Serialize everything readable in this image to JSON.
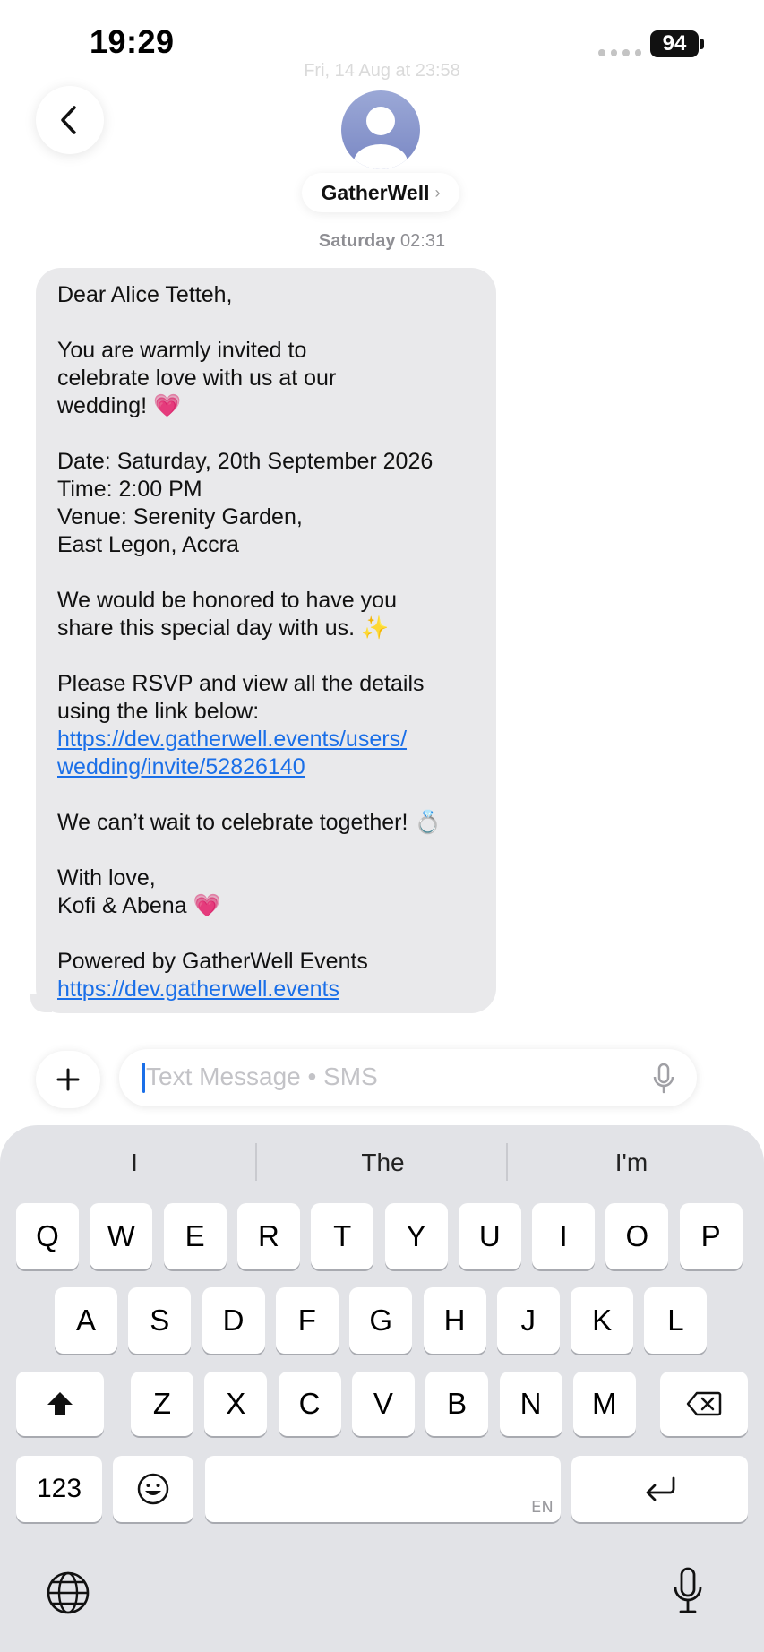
{
  "status": {
    "time": "19:29",
    "battery": "94"
  },
  "header": {
    "date": "Fri, 14 Aug at 23:58",
    "contact_name": "GatherWell",
    "chevron": "›"
  },
  "thread": {
    "timestamp_day": "Saturday",
    "timestamp_time": "02:31",
    "message_lines": [
      {
        "text": "Dear Alice Tetteh,"
      },
      {
        "text": ""
      },
      {
        "text": "You are warmly invited to"
      },
      {
        "text": "celebrate love with us at our"
      },
      {
        "text": "wedding! 💗"
      },
      {
        "text": ""
      },
      {
        "text": "Date: Saturday, 20th September 2026"
      },
      {
        "text": "Time: 2:00 PM"
      },
      {
        "text": "Venue: Serenity Garden,"
      },
      {
        "text": "East Legon, Accra"
      },
      {
        "text": ""
      },
      {
        "text": "We would be honored to have you"
      },
      {
        "text": "share this special day with us. ✨"
      },
      {
        "text": ""
      },
      {
        "text": "Please RSVP and view all the details"
      },
      {
        "text": "using the link below:"
      },
      {
        "text": "https://dev.gatherwell.events/users/",
        "link": true
      },
      {
        "text": "wedding/invite/52826140",
        "link": true
      },
      {
        "text": ""
      },
      {
        "text": "We can’t wait to celebrate together! 💍"
      },
      {
        "text": ""
      },
      {
        "text": "With love,"
      },
      {
        "text": "Kofi & Abena 💗"
      },
      {
        "text": ""
      },
      {
        "text": "Powered by GatherWell Events"
      },
      {
        "text": "https://dev.gatherwell.events",
        "link": true
      }
    ]
  },
  "composer": {
    "placeholder": "Text Message • SMS"
  },
  "keyboard": {
    "suggestions": [
      "I",
      "The",
      "I'm"
    ],
    "row1": [
      "Q",
      "W",
      "E",
      "R",
      "T",
      "Y",
      "U",
      "I",
      "O",
      "P"
    ],
    "row2": [
      "A",
      "S",
      "D",
      "F",
      "G",
      "H",
      "J",
      "K",
      "L"
    ],
    "row3": [
      "Z",
      "X",
      "C",
      "V",
      "B",
      "N",
      "M"
    ],
    "numbers_label": "123",
    "language_label": "EN"
  },
  "colors": {
    "link": "#1a6fe8",
    "bubble": "#e9e9eb",
    "keyboard_bg": "#e2e3e7"
  }
}
